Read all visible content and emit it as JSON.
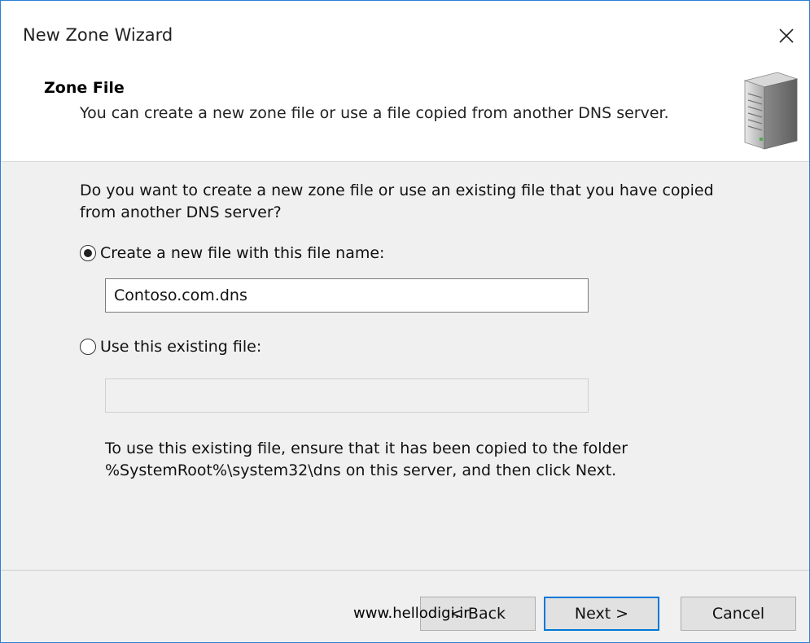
{
  "window": {
    "title": "New Zone Wizard"
  },
  "header": {
    "title": "Zone File",
    "subtitle": "You can create a new zone file or use a file copied from another DNS server."
  },
  "content": {
    "question": "Do you want to create a new zone file or use an existing file that you have copied from another DNS server?",
    "option_new": {
      "label": "Create a new file with this file name:",
      "selected": true,
      "value": "Contoso.com.dns"
    },
    "option_existing": {
      "label": "Use this existing file:",
      "selected": false,
      "value": ""
    },
    "info": "To use this existing file, ensure that it has been copied to the folder %SystemRoot%\\system32\\dns on this server, and then click Next."
  },
  "buttons": {
    "back": "< Back",
    "next": "Next >",
    "cancel": "Cancel"
  },
  "watermark": "www.hellodigi.ir",
  "icons": {
    "close": "close-icon",
    "server": "server-icon"
  },
  "colors": {
    "accent": "#0078d7",
    "window_border": "#2b7fd6"
  }
}
